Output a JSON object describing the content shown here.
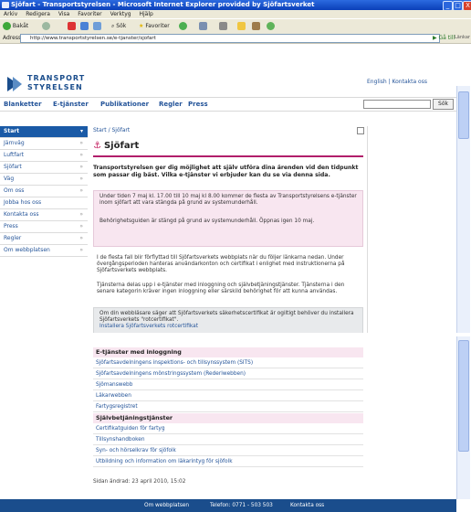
{
  "window": {
    "title": "Sjöfart - Transportstyrelsen - Microsoft Internet Explorer provided by Sjöfartsverket",
    "minimize": "_",
    "maximize": "□",
    "close": "X"
  },
  "menubar": [
    "Arkiv",
    "Redigera",
    "Visa",
    "Favoriter",
    "Verktyg",
    "Hjälp"
  ],
  "toolbar": {
    "back": "Bakåt",
    "search": "Sök",
    "favorites": "Favoriter"
  },
  "address": {
    "label": "Adress",
    "url": "http://www.transportstyrelsen.se/e-tjanster/sjofart",
    "go": "Gå till",
    "links": "Länkar"
  },
  "site": {
    "logo_line1": "TRANSPORT",
    "logo_line2": "STYRELSEN",
    "toplinks": "English | Kontakta oss",
    "nav": [
      "Blanketter",
      "E-tjänster",
      "Publikationer",
      "Regler",
      "Press"
    ],
    "search_button": "Sök"
  },
  "sidebar": {
    "items": [
      {
        "label": "Start",
        "arrow": "▾"
      },
      {
        "label": "Järnväg",
        "arrow": "»"
      },
      {
        "label": "Luftfart",
        "arrow": "»"
      },
      {
        "label": "Sjöfart",
        "arrow": "»"
      },
      {
        "label": "Väg",
        "arrow": "»"
      },
      {
        "label": "Om oss",
        "arrow": "»"
      },
      {
        "label": "Jobba hos oss",
        "arrow": ""
      },
      {
        "label": "Kontakta oss",
        "arrow": "»"
      },
      {
        "label": "Press",
        "arrow": "»"
      },
      {
        "label": "Regler",
        "arrow": "»"
      },
      {
        "label": "Om webbplatsen",
        "arrow": "»"
      }
    ]
  },
  "main": {
    "breadcrumb": "Start / Sjöfart",
    "title": "Sjöfart",
    "intro": "Transportstyrelsen ger dig möjlighet att själv utföra dina ärenden vid den tidpunkt som passar dig bäst. Vilka e-tjänster vi erbjuder kan du se via denna sida.",
    "notice_a": "Under tiden 7 maj kl. 17.00 till 10 maj kl 8.00 kommer de flesta av Transportstyrelsens e-tjänster inom sjöfart att vara stängda på grund av systemunderhåll.",
    "notice_b": "Behörighetsguiden är stängd på grund av systemunderhåll. Öppnas igen 10 maj.",
    "para1": "I de flesta fall blir förflyttad till Sjöfartsverkets webbplats när du följer länkarna nedan. Under övergångsperioden hanteras användarkonton och certifikat i enlighet med instruktionerna på Sjöfartsverkets webbplats.",
    "para2": "Tjänsterna delas upp i e-tjänster med inloggning och självbetjäningstjänster. Tjänsterna i den senare kategorin kräver ingen inloggning eller särskild behörighet för att kunna användas.",
    "cert_text": "Om din webbläsare säger att Sjöfartsverkets säkerhetscertifikat är ogiltigt behöver du installera Sjöfartsverkets \"rotcertifikat\".",
    "cert_link": "Installera Sjöfartsverkets rotcertifikat"
  },
  "lower": {
    "heading1": "E-tjänster med inloggning",
    "list1": [
      "Sjöfartsavdelningens inspektions- och tillsynssystem (SITS)",
      "Sjöfartsavdelningens mönstringssystem (Rederiwebben)",
      "Sjömanswebb",
      "Läkarwebben",
      "Fartygsregistret"
    ],
    "heading2": "Självbetjäningstjänster",
    "list2": [
      "Certifikatguiden för fartyg",
      "Tillsynshandboken",
      "Syn- och hörselkrav för sjöfolk",
      "Utbildning och information om läkarintyg för sjöfolk"
    ],
    "changed": "Sidan ändrad: 23 april 2010, 15:02"
  },
  "footer": {
    "a": "Om webbplatsen",
    "b": "Telefon: 0771 - 503 503",
    "c": "Kontakta oss"
  },
  "colors": {
    "accent": "#b11e6b",
    "brand": "#1a4d8c",
    "sidebar_active": "#1a5aa6"
  }
}
